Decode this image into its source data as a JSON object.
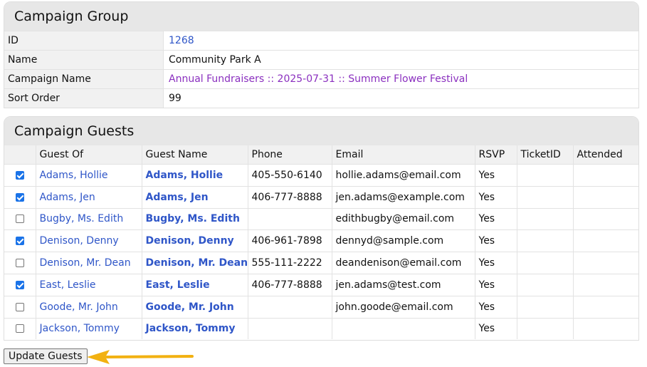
{
  "group": {
    "title": "Campaign Group",
    "rows": [
      {
        "label": "ID",
        "value": "1268"
      },
      {
        "label": "Name",
        "value": "Community Park A"
      },
      {
        "label": "Campaign Name",
        "value": "Annual Fundraisers :: 2025-07-31 :: Summer Flower Festival"
      },
      {
        "label": "Sort Order",
        "value": "99"
      }
    ]
  },
  "guests": {
    "title": "Campaign Guests",
    "columns": [
      "",
      "Guest Of",
      "Guest Name",
      "Phone",
      "Email",
      "RSVP",
      "TicketID",
      "Attended"
    ],
    "rows": [
      {
        "checked": true,
        "guest_of": "Adams, Hollie",
        "name": "Adams, Hollie",
        "phone": "405-550-6140",
        "email": "hollie.adams@email.com",
        "rsvp": "Yes",
        "ticket": "",
        "attended": ""
      },
      {
        "checked": true,
        "guest_of": "Adams, Jen",
        "name": "Adams, Jen",
        "phone": "406-777-8888",
        "email": "jen.adams@example.com",
        "rsvp": "Yes",
        "ticket": "",
        "attended": ""
      },
      {
        "checked": false,
        "guest_of": "Bugby, Ms. Edith",
        "name": "Bugby, Ms. Edith",
        "phone": "",
        "email": "edithbugby@email.com",
        "rsvp": "Yes",
        "ticket": "",
        "attended": ""
      },
      {
        "checked": true,
        "guest_of": "Denison, Denny",
        "name": "Denison, Denny",
        "phone": "406-961-7898",
        "email": "dennyd@sample.com",
        "rsvp": "Yes",
        "ticket": "",
        "attended": ""
      },
      {
        "checked": false,
        "guest_of": "Denison, Mr. Dean",
        "name": "Denison, Mr. Dean",
        "phone": "555-111-2222",
        "email": "deandenison@email.com",
        "rsvp": "Yes",
        "ticket": "",
        "attended": ""
      },
      {
        "checked": true,
        "guest_of": "East, Leslie",
        "name": "East, Leslie",
        "phone": "406-777-8888",
        "email": "jen.adams@test.com",
        "rsvp": "Yes",
        "ticket": "",
        "attended": ""
      },
      {
        "checked": false,
        "guest_of": "Goode, Mr. John",
        "name": "Goode, Mr. John",
        "phone": "",
        "email": "john.goode@email.com",
        "rsvp": "Yes",
        "ticket": "",
        "attended": ""
      },
      {
        "checked": false,
        "guest_of": "Jackson, Tommy",
        "name": "Jackson, Tommy",
        "phone": "",
        "email": "",
        "rsvp": "Yes",
        "ticket": "",
        "attended": ""
      }
    ]
  },
  "actions": {
    "update_label": "Update Guests"
  },
  "colors": {
    "link": "#2f56c8",
    "campaign_link": "#8a2fbf",
    "checkbox": "#1a73e8",
    "arrow": "#f2b111"
  }
}
